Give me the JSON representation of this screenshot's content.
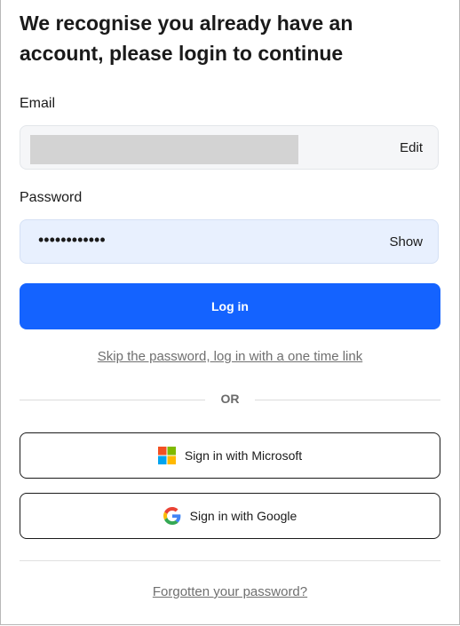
{
  "heading": "We recognise you already have an account, please login to continue",
  "email": {
    "label": "Email",
    "value": "",
    "action": "Edit"
  },
  "password": {
    "label": "Password",
    "value": "••••••••••••",
    "action": "Show"
  },
  "login_button": "Log in",
  "skip_link": "Skip the password, log in with a one time link",
  "divider_text": "OR",
  "sso": {
    "microsoft": {
      "label": "Sign in with Microsoft",
      "icon": "microsoft-logo-icon"
    },
    "google": {
      "label": "Sign in with Google",
      "icon": "google-logo-icon"
    }
  },
  "forgot_link": "Forgotten your password?",
  "colors": {
    "primary": "#1463ff",
    "password_bg": "#e8f0fe",
    "email_bg": "#f5f6f8"
  }
}
